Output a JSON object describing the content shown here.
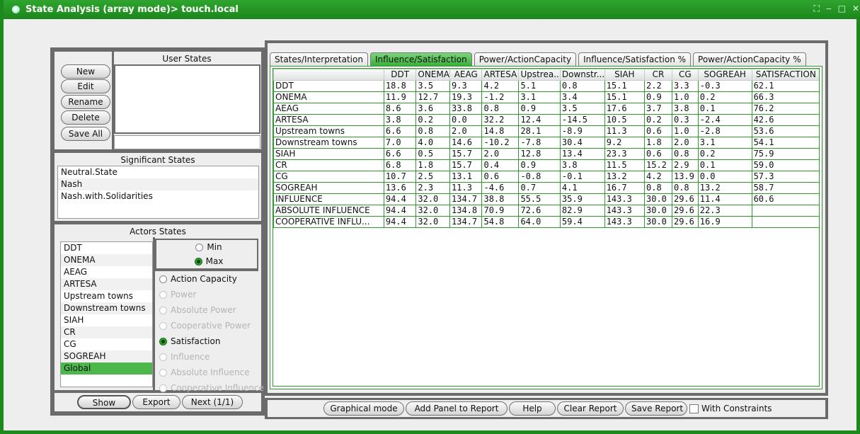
{
  "window": {
    "title": "State Analysis (array mode)> touch.local"
  },
  "user_states": {
    "title": "User States",
    "buttons": [
      "New",
      "Edit",
      "Rename",
      "Delete",
      "Save All"
    ]
  },
  "significant_states": {
    "title": "Significant States",
    "items": [
      "Neutral.State",
      "Nash",
      "Nash.with.Solidarities"
    ]
  },
  "actors_states": {
    "title": "Actors States",
    "actors": [
      "DDT",
      "ONEMA",
      "AEAG",
      "ARTESA",
      "Upstream towns",
      "Downstream towns",
      "SIAH",
      "CR",
      "CG",
      "SOGREAH",
      "Global"
    ],
    "selected_actor": "Global",
    "minmax": [
      {
        "label": "Min",
        "checked": false
      },
      {
        "label": "Max",
        "checked": true
      }
    ],
    "options": [
      {
        "label": "Action Capacity",
        "checked": false,
        "enabled": true
      },
      {
        "label": "Power",
        "checked": false,
        "enabled": false
      },
      {
        "label": "Absolute Power",
        "checked": false,
        "enabled": false
      },
      {
        "label": "Cooperative Power",
        "checked": false,
        "enabled": false
      },
      {
        "label": "Satisfaction",
        "checked": true,
        "enabled": true
      },
      {
        "label": "Influence",
        "checked": false,
        "enabled": false
      },
      {
        "label": "Absolute Influence",
        "checked": false,
        "enabled": false
      },
      {
        "label": "Cooperative Influence",
        "checked": false,
        "enabled": false
      }
    ]
  },
  "left_bottom_buttons": {
    "show": "Show",
    "export": "Export",
    "next": "Next (1/1)"
  },
  "tabs": [
    {
      "label": "States/Interpretation",
      "active": false
    },
    {
      "label": "Influence/Satisfaction",
      "active": true
    },
    {
      "label": "Power/ActionCapacity",
      "active": false
    },
    {
      "label": "Influence/Satisfaction %",
      "active": false
    },
    {
      "label": "Power/ActionCapacity %",
      "active": false
    }
  ],
  "table": {
    "headers": [
      "",
      "DDT",
      "ONEMA",
      "AEAG",
      "ARTESA",
      "Upstrea...",
      "Downstr...",
      "SIAH",
      "CR",
      "CG",
      "SOGREAH",
      "SATISFACTION"
    ],
    "rows": [
      [
        "DDT",
        "18.8",
        "3.5",
        "9.3",
        "4.2",
        "5.1",
        "0.8",
        "15.1",
        "2.2",
        "3.3",
        "-0.3",
        "62.1"
      ],
      [
        "ONEMA",
        "11.9",
        "12.7",
        "19.3",
        "-1.2",
        "3.1",
        "3.4",
        "15.1",
        "0.9",
        "1.0",
        "0.2",
        "66.3"
      ],
      [
        "AEAG",
        "8.6",
        "3.6",
        "33.8",
        "0.8",
        "0.9",
        "3.5",
        "17.6",
        "3.7",
        "3.8",
        "0.1",
        "76.2"
      ],
      [
        "ARTESA",
        "3.8",
        "0.2",
        "0.0",
        "32.2",
        "12.4",
        "-14.5",
        "10.5",
        "0.2",
        "0.3",
        "-2.4",
        "42.6"
      ],
      [
        "Upstream towns",
        "6.6",
        "0.8",
        "2.0",
        "14.8",
        "28.1",
        "-8.9",
        "11.3",
        "0.6",
        "1.0",
        "-2.8",
        "53.6"
      ],
      [
        "Downstream towns",
        "7.0",
        "4.0",
        "14.6",
        "-10.2",
        "-7.8",
        "30.4",
        "9.2",
        "1.8",
        "2.0",
        "3.1",
        "54.1"
      ],
      [
        "SIAH",
        "6.6",
        "0.5",
        "15.7",
        "2.0",
        "12.8",
        "13.4",
        "23.3",
        "0.6",
        "0.8",
        "0.2",
        "75.9"
      ],
      [
        "CR",
        "6.8",
        "1.8",
        "15.7",
        "0.4",
        "0.9",
        "3.8",
        "11.5",
        "15.2",
        "2.9",
        "0.1",
        "59.0"
      ],
      [
        "CG",
        "10.7",
        "2.5",
        "13.1",
        "0.6",
        "-0.8",
        "-0.1",
        "13.2",
        "4.2",
        "13.9",
        "0.0",
        "57.3"
      ],
      [
        "SOGREAH",
        "13.6",
        "2.3",
        "11.3",
        "-4.6",
        "0.7",
        "4.1",
        "16.7",
        "0.8",
        "0.8",
        "13.2",
        "58.7"
      ],
      [
        "INFLUENCE",
        "94.4",
        "32.0",
        "134.7",
        "38.8",
        "55.5",
        "35.9",
        "143.3",
        "30.0",
        "29.6",
        "11.4",
        "60.6"
      ],
      [
        "ABSOLUTE INFLUENCE",
        "94.4",
        "32.0",
        "134.8",
        "70.9",
        "72.6",
        "82.9",
        "143.3",
        "30.0",
        "29.6",
        "22.3",
        ""
      ],
      [
        "COOPERATIVE INFLU...",
        "94.4",
        "32.0",
        "134.7",
        "54.8",
        "64.0",
        "59.4",
        "143.3",
        "30.0",
        "29.6",
        "16.9",
        ""
      ]
    ]
  },
  "bottom_toolbar": {
    "graphical_mode": "Graphical mode",
    "add_panel": "Add Panel to Report",
    "help": "Help",
    "clear_report": "Clear Report",
    "save_report": "Save Report",
    "with_constraints": "With Constraints",
    "with_constraints_checked": false
  }
}
